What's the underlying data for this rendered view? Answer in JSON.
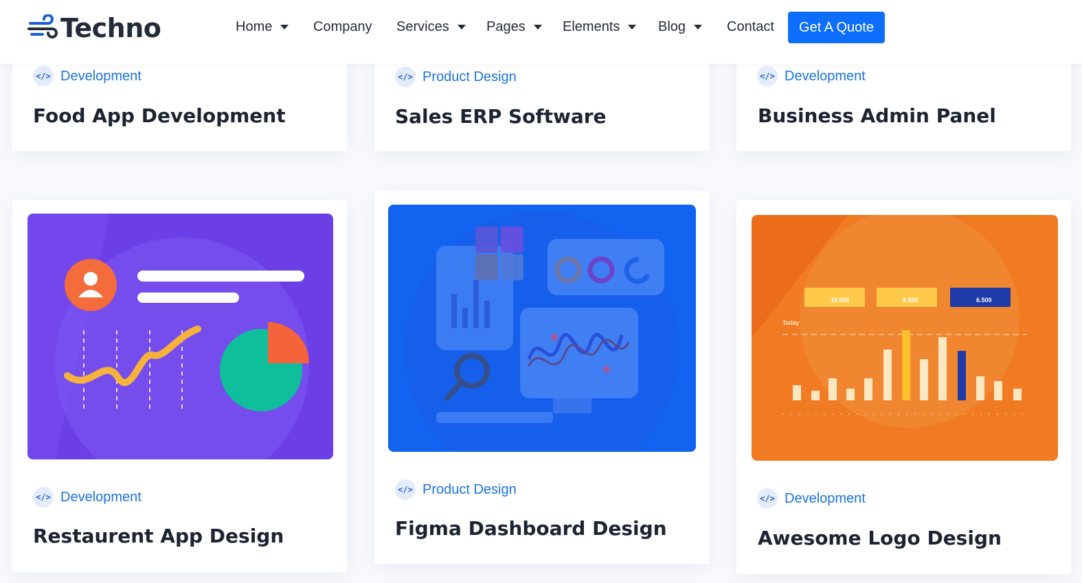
{
  "brand": {
    "name": "Techno",
    "accent": "#0d6efd"
  },
  "nav": {
    "items": [
      {
        "label": "Home",
        "has_dropdown": true
      },
      {
        "label": "Company",
        "has_dropdown": false
      },
      {
        "label": "Services",
        "has_dropdown": true
      },
      {
        "label": "Pages",
        "has_dropdown": true
      },
      {
        "label": "Elements",
        "has_dropdown": true
      },
      {
        "label": "Blog",
        "has_dropdown": true
      },
      {
        "label": "Contact",
        "has_dropdown": false
      }
    ],
    "cta_label": "Get A Quote"
  },
  "projects": [
    {
      "category": "Development",
      "title": "Food App Development"
    },
    {
      "category": "Product Design",
      "title": "Sales ERP Software"
    },
    {
      "category": "Development",
      "title": "Business Admin Panel"
    },
    {
      "category": "Development",
      "title": "Restaurent App Design",
      "image_bg": "#6c3fe6"
    },
    {
      "category": "Product Design",
      "title": "Figma Dashboard Design",
      "image_bg": "#1163f0"
    },
    {
      "category": "Development",
      "title": "Awesome Logo Design",
      "image_bg": "#f07b22"
    }
  ],
  "logo_dashboard": {
    "stats": [
      "10.500",
      "8.500",
      "6.500"
    ],
    "label": "Today"
  },
  "icons": {
    "category": "code-icon",
    "dropdown": "caret-down-icon",
    "logo": "wind-icon"
  }
}
